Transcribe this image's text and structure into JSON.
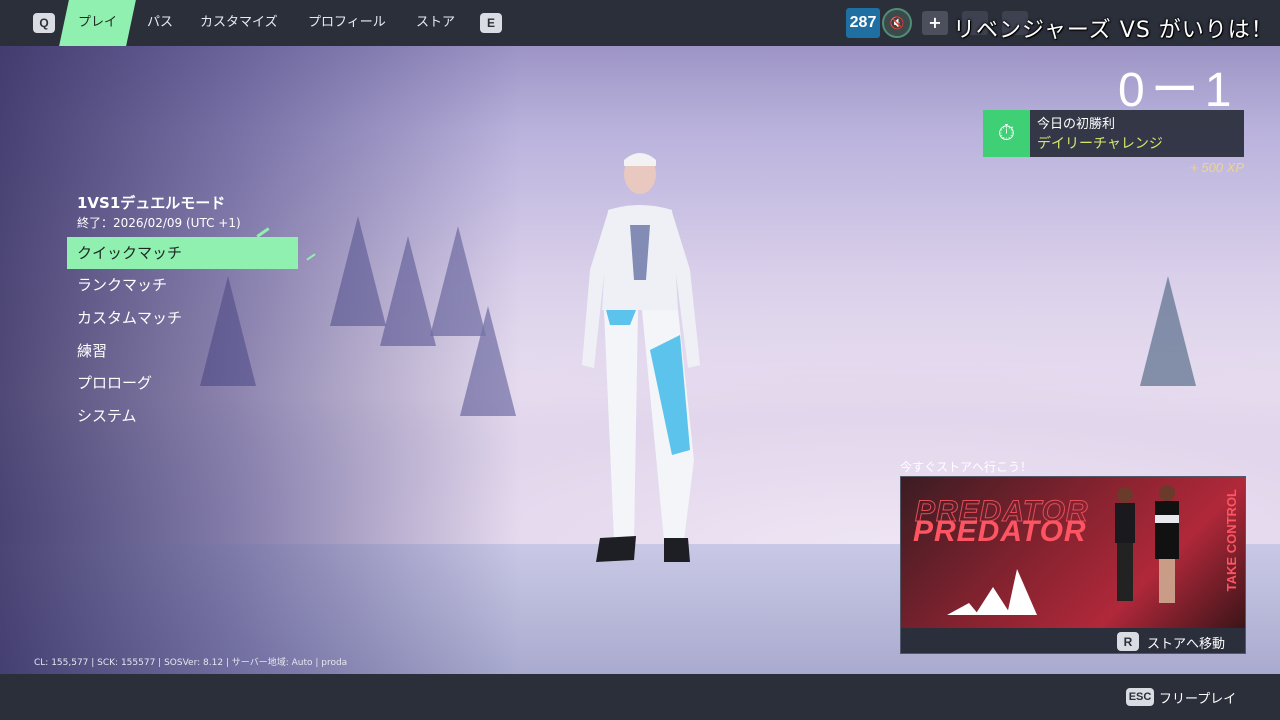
{
  "nav": {
    "key_left": "Q",
    "key_right": "E",
    "tabs": [
      {
        "label": "プレイ"
      },
      {
        "label": "パス"
      },
      {
        "label": "カスタマイズ"
      },
      {
        "label": "プロフィール"
      },
      {
        "label": "ストア"
      }
    ],
    "active_tab": "プレイ"
  },
  "currency": {
    "value": "287"
  },
  "mute_icon": "speaker-mute-icon",
  "plus_label": "+",
  "overlay_title": "リベンジャーズ VS がいりは！",
  "score": "0ー1",
  "daily_challenge": {
    "title": "今日の初勝利",
    "subtitle": "デイリーチャレンジ",
    "reward": "+ 500 XP",
    "icon": "stopwatch-icon",
    "accent": "#3fcf74"
  },
  "mode": {
    "title": "1VS1デュエルモード",
    "end_date": "終了：2026/02/09 (UTC +1)"
  },
  "menu": {
    "items": [
      {
        "label": "クイックマッチ"
      },
      {
        "label": "ランクマッチ"
      },
      {
        "label": "カスタムマッチ"
      },
      {
        "label": "練習"
      },
      {
        "label": "プロローグ"
      },
      {
        "label": "システム"
      }
    ],
    "selected": "クイックマッチ",
    "accent": "#8ff0b0"
  },
  "promo": {
    "caption": "今すぐストアへ行こう！",
    "brand": "PREDATOR",
    "side_text": "TAKE CONTROL",
    "key": "R",
    "link_label": "ストアへ移動"
  },
  "build_info": "CL: 155,577 | SCK: 155577 | SOSVer: 8.12 | サーバー地域: Auto | proda",
  "footer": {
    "key": "ESC",
    "label": "フリープレイ"
  }
}
